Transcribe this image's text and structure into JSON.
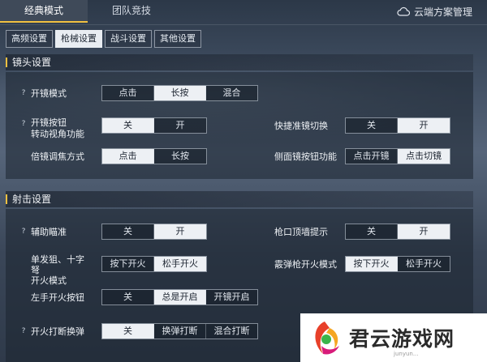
{
  "top_tabs": [
    {
      "label": "经典模式",
      "active": true
    },
    {
      "label": "团队竞技",
      "active": false
    }
  ],
  "cloud": {
    "label": "云端方案管理",
    "icon": "cloud-icon"
  },
  "sub_tabs": [
    {
      "label": "高频设置",
      "active": false
    },
    {
      "label": "枪械设置",
      "active": true
    },
    {
      "label": "战斗设置",
      "active": false
    },
    {
      "label": "其他设置",
      "active": false
    }
  ],
  "sections": {
    "scope": {
      "title": "镜头设置"
    },
    "fire": {
      "title": "射击设置"
    }
  },
  "scope_rows": {
    "scope_mode": {
      "label": "开镜模式",
      "options": [
        "点击",
        "长按",
        "混合"
      ],
      "selected": 1
    },
    "scope_button_rotate": {
      "label_line1": "开镜按钮",
      "label_line2": "转动视角功能",
      "options": [
        "关",
        "开"
      ],
      "selected": 0
    },
    "quick_scope_switch": {
      "label": "快捷准镜切换",
      "options": [
        "关",
        "开"
      ],
      "selected": 1
    },
    "zoom_mode": {
      "label": "倍镜调焦方式",
      "options": [
        "点击",
        "长按"
      ],
      "selected": 0
    },
    "side_scope_button": {
      "label": "侧面镜按钮功能",
      "options": [
        "点击开镜",
        "点击切镜"
      ],
      "selected": 1
    }
  },
  "fire_rows": {
    "aim_assist": {
      "label": "辅助瞄准",
      "options": [
        "关",
        "开"
      ],
      "selected": 1
    },
    "muzzle_wall_hint": {
      "label": "枪口顶墙提示",
      "options": [
        "关",
        "开"
      ],
      "selected": 1
    },
    "single_shot_mode": {
      "label_line1": "单发狙、十字",
      "label_line2": "弩",
      "label_line3": "开火模式",
      "options": [
        "按下开火",
        "松手开火"
      ],
      "selected": 1
    },
    "shotgun_mode": {
      "label": "霰弹枪开火模式",
      "options": [
        "按下开火",
        "松手开火"
      ],
      "selected": 0
    },
    "left_fire_button": {
      "label": "左手开火按钮",
      "options": [
        "关",
        "总是开启",
        "开镜开启"
      ],
      "selected": 1
    },
    "fire_interrupt_reload": {
      "label": "开火打断换弹",
      "options": [
        "关",
        "换弹打断",
        "混合打断"
      ],
      "selected": 0
    }
  },
  "help_mark": "?",
  "watermark": {
    "text": "君云游戏网",
    "sub": "junyun..."
  }
}
